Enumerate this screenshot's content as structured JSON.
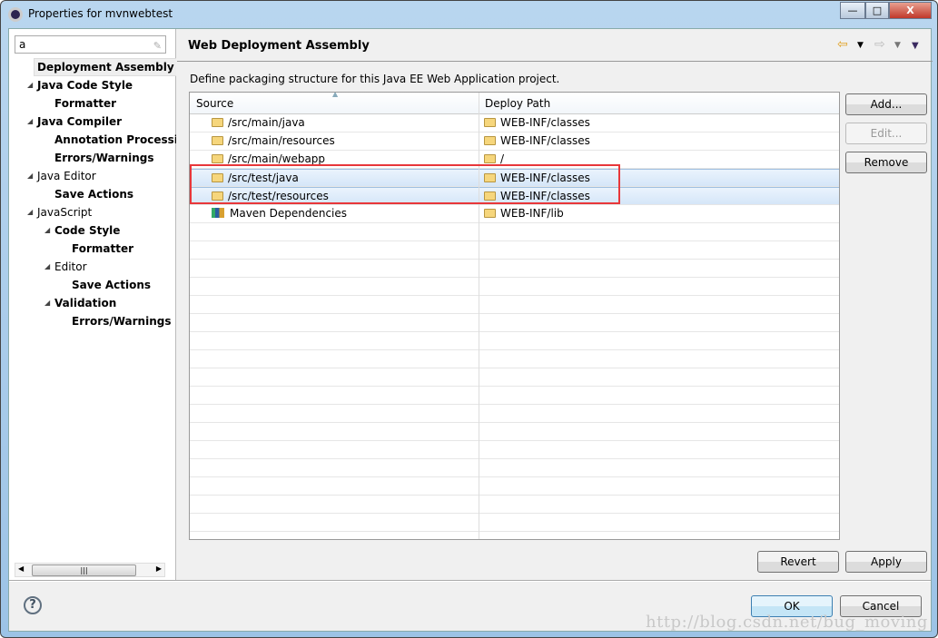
{
  "window": {
    "title": "Properties for mvnwebtest",
    "minimize": "—",
    "maximize": "□",
    "close": "X"
  },
  "filter": {
    "value": "a"
  },
  "tree": [
    {
      "label": "Deployment Assembly",
      "indent": 1,
      "bold": true,
      "selected": true,
      "expander": false
    },
    {
      "label": "Java Code Style",
      "indent": 1,
      "bold": true,
      "expander": true
    },
    {
      "label": "Formatter",
      "indent": 2,
      "bold": true,
      "expander": false
    },
    {
      "label": "Java Compiler",
      "indent": 1,
      "bold": true,
      "expander": true
    },
    {
      "label": "Annotation Processi",
      "indent": 2,
      "bold": true,
      "expander": false
    },
    {
      "label": "Errors/Warnings",
      "indent": 2,
      "bold": true,
      "expander": false
    },
    {
      "label": "Java Editor",
      "indent": 1,
      "bold": false,
      "expander": true
    },
    {
      "label": "Save Actions",
      "indent": 2,
      "bold": true,
      "expander": false
    },
    {
      "label": "JavaScript",
      "indent": 1,
      "bold": false,
      "expander": true
    },
    {
      "label": "Code Style",
      "indent": 2,
      "bold": true,
      "expander": true
    },
    {
      "label": "Formatter",
      "indent": 3,
      "bold": true,
      "expander": false
    },
    {
      "label": "Editor",
      "indent": 2,
      "bold": false,
      "expander": true
    },
    {
      "label": "Save Actions",
      "indent": 3,
      "bold": true,
      "expander": false
    },
    {
      "label": "Validation",
      "indent": 2,
      "bold": true,
      "expander": true
    },
    {
      "label": "Errors/Warnings",
      "indent": 3,
      "bold": true,
      "expander": false
    }
  ],
  "page": {
    "title": "Web Deployment Assembly",
    "description": "Define packaging structure for this Java EE Web Application project."
  },
  "table": {
    "columns": [
      "Source",
      "Deploy Path"
    ],
    "rows": [
      {
        "source": "/src/main/java",
        "deploy": "WEB-INF/classes",
        "icon": "folder",
        "selected": false
      },
      {
        "source": "/src/main/resources",
        "deploy": "WEB-INF/classes",
        "icon": "folder",
        "selected": false
      },
      {
        "source": "/src/main/webapp",
        "deploy": "/",
        "icon": "folder",
        "selected": false
      },
      {
        "source": "/src/test/java",
        "deploy": "WEB-INF/classes",
        "icon": "folder",
        "selected": true
      },
      {
        "source": "/src/test/resources",
        "deploy": "WEB-INF/classes",
        "icon": "folder",
        "selected": true
      },
      {
        "source": "Maven Dependencies",
        "deploy": "WEB-INF/lib",
        "icon": "library",
        "selected": false
      }
    ]
  },
  "buttons": {
    "add": "Add...",
    "edit": "Edit...",
    "remove": "Remove",
    "revert": "Revert",
    "apply": "Apply",
    "ok": "OK",
    "cancel": "Cancel"
  },
  "colors": {
    "highlight_box": "#e8373a",
    "selection": "#d5e6f8"
  },
  "watermark": "http://blog.csdn.net/bug_moving"
}
